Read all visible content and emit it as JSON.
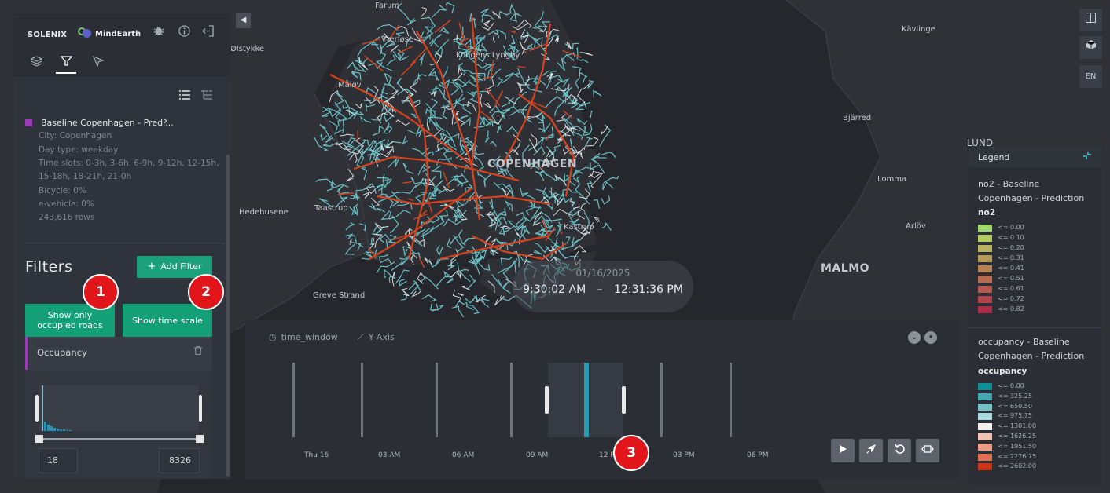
{
  "brand": {
    "company": "SOLENIX",
    "partner": "MindEarth"
  },
  "header_icons": [
    "bug-icon",
    "info-icon",
    "logout-icon"
  ],
  "tabs": [
    {
      "name": "layers-tab",
      "icon": "layers-icon",
      "active": false
    },
    {
      "name": "filters-tab",
      "icon": "filter-icon",
      "active": true
    },
    {
      "name": "interactions-tab",
      "icon": "pointer-icon",
      "active": false
    }
  ],
  "dataset": {
    "name": "Baseline Copenhagen - Predi...",
    "color": "#9b3cb7",
    "meta": [
      "City: Copenhagen",
      "Day type: weekday",
      "Time slots: 0-3h, 3-6h, 6-9h, 9-12h, 12-15h,",
      "15-18h, 18-21h, 21-0h",
      "Bicycle: 0%",
      "e-vehicle: 0%",
      "243,616 rows"
    ]
  },
  "filters": {
    "title": "Filters",
    "add_label": "Add Filter",
    "show_occupied": "Show only occupied roads",
    "show_timescale": "Show time scale",
    "occupancy_label": "Occupancy",
    "range_min": "18",
    "range_max": "8326"
  },
  "map_controls": [
    "split-map-icon",
    "3d-view-icon",
    "EN"
  ],
  "places": {
    "farum": "Farum",
    "vaerlose": "Værløse",
    "olstykke": "Ølstykke",
    "kongens_lyngby": "Kongens Lyngby",
    "malov": "Måløv",
    "copenhagen": "COPENHAGEN",
    "hedehusene": "Hedehusene",
    "taastrup": "Taastrup",
    "greve": "Greve Strand",
    "kavlinge": "Kävlinge",
    "bjarred": "Bjärred",
    "lund": "LUND",
    "lomma": "Lomma",
    "arlov": "Arlöv",
    "malmo": "MALMO",
    "kastrup": "Kastrup"
  },
  "legend": {
    "title": "Legend",
    "no2": {
      "layer": "no2 - Baseline Copenhagen - Prediction",
      "variable": "no2",
      "items": [
        {
          "label": "<= 0.00",
          "color": "#9ed86a"
        },
        {
          "label": "<= 0.10",
          "color": "#b5cc63"
        },
        {
          "label": "<= 0.20",
          "color": "#b8b35e"
        },
        {
          "label": "<= 0.31",
          "color": "#b99b58"
        },
        {
          "label": "<= 0.41",
          "color": "#b98252"
        },
        {
          "label": "<= 0.51",
          "color": "#b86c4f"
        },
        {
          "label": "<= 0.61",
          "color": "#b6584d"
        },
        {
          "label": "<= 0.72",
          "color": "#b2424b"
        },
        {
          "label": "<= 0.82",
          "color": "#ad2d49"
        }
      ]
    },
    "occupancy": {
      "layer": "occupancy - Baseline Copenhagen - Prediction",
      "variable": "occupancy",
      "items": [
        {
          "label": "<= 0.00",
          "color": "#0f8f98"
        },
        {
          "label": "<= 325.25",
          "color": "#43a9b1"
        },
        {
          "label": "<= 650.50",
          "color": "#74c1c5"
        },
        {
          "label": "<= 975.75",
          "color": "#a8d9da"
        },
        {
          "label": "<= 1301.00",
          "color": "#f4f0ec"
        },
        {
          "label": "<= 1626.25",
          "color": "#f1c3b3"
        },
        {
          "label": "<= 1951.50",
          "color": "#ec9c82"
        },
        {
          "label": "<= 2276.75",
          "color": "#e26f4f"
        },
        {
          "label": "<= 2602.00",
          "color": "#cc3415"
        }
      ]
    }
  },
  "time": {
    "date": "01/16/2025",
    "start": "9:30:02 AM",
    "dash": "–",
    "end": "12:31:36 PM"
  },
  "timeline": {
    "tab_time": "time_window",
    "tab_y": "Y Axis",
    "ticks": [
      "Thu 16",
      "03 AM",
      "06 AM",
      "09 AM",
      "12 PM",
      "03 PM",
      "06 PM"
    ],
    "buttons": [
      "play-icon",
      "rocket-icon",
      "reset-icon",
      "fit-icon"
    ]
  },
  "callouts": [
    "1",
    "2",
    "3"
  ]
}
